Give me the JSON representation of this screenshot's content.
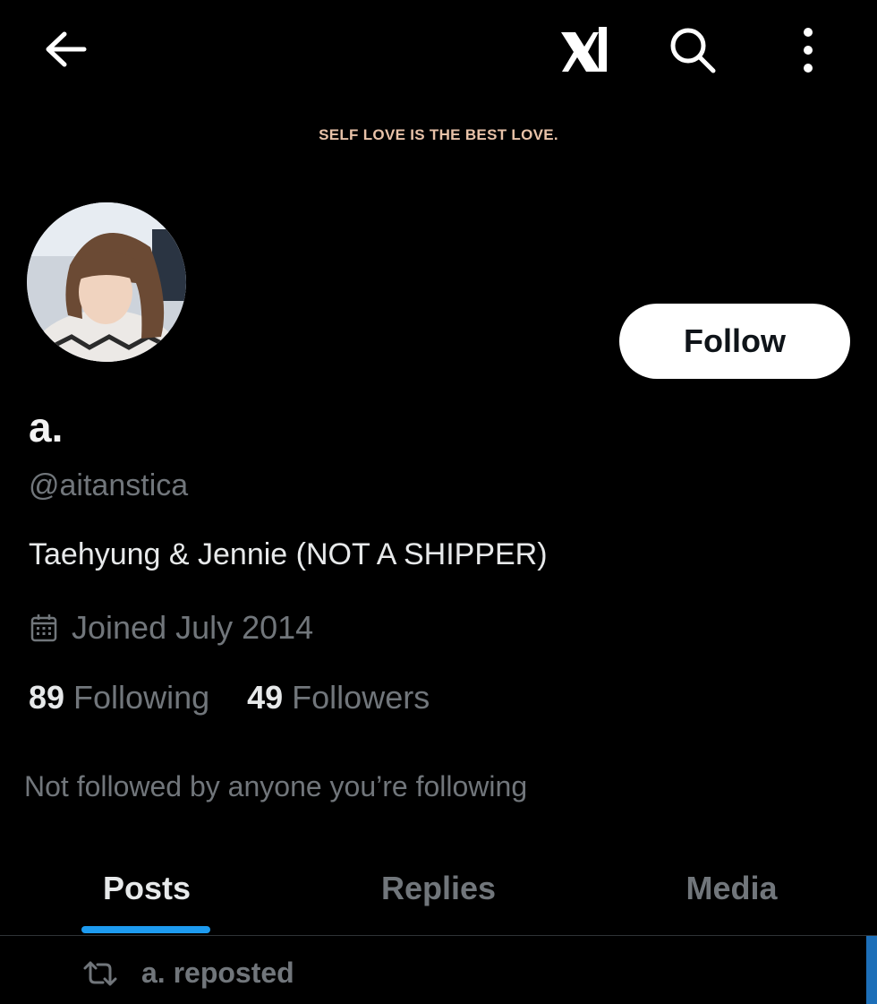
{
  "header": {
    "back_icon": "arrow-left-icon",
    "logo_icon": "x-logo-icon",
    "search_icon": "search-icon",
    "more_icon": "more-vertical-icon"
  },
  "banner": {
    "text": "SELF LOVE IS THE BEST LOVE.",
    "color": "#e8c2a8"
  },
  "profile": {
    "display_name": "a.",
    "handle": "@aitanstica",
    "bio": "Taehyung & Jennie (NOT A SHIPPER)",
    "joined": "Joined July 2014",
    "follow_label": "Follow"
  },
  "stats": {
    "following_count": "89",
    "following_label": "Following",
    "followers_count": "49",
    "followers_label": "Followers"
  },
  "not_followed_text": "Not followed by anyone you’re following",
  "tabs": [
    {
      "label": "Posts",
      "active": true
    },
    {
      "label": "Replies",
      "active": false
    },
    {
      "label": "Media",
      "active": false
    }
  ],
  "feed": {
    "repost_text": "a. reposted",
    "repost_icon": "repost-icon"
  },
  "colors": {
    "accent": "#1d9bf0",
    "background": "#000000",
    "secondary_text": "#71767b"
  }
}
